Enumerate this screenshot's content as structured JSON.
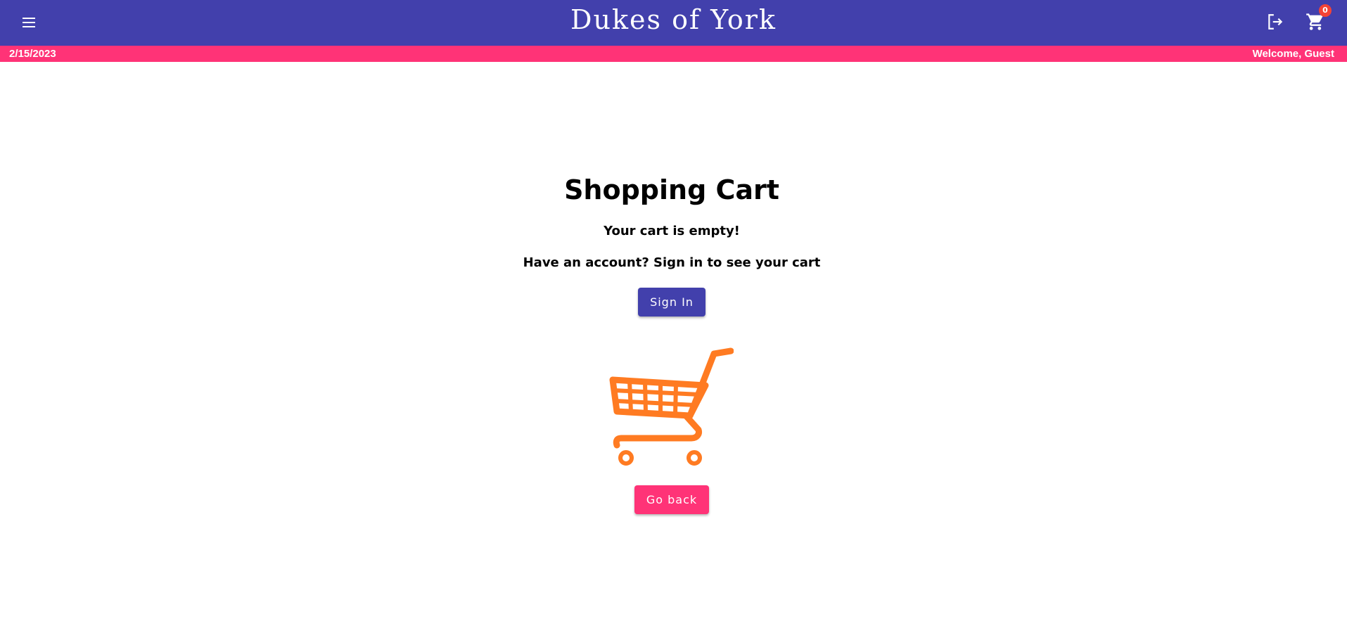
{
  "header": {
    "brand": "Dukes of York",
    "cart_count": "0",
    "icons": {
      "menu": "menu-icon",
      "logout": "logout-icon",
      "cart": "shopping-cart-icon"
    },
    "colors": {
      "primary": "#4240ac",
      "accent": "#ff3377",
      "badge": "#f44336"
    }
  },
  "statusbar": {
    "date": "2/15/2023",
    "welcome": "Welcome, Guest"
  },
  "main": {
    "title": "Shopping Cart",
    "empty_message": "Your cart is empty!",
    "account_prompt": "Have an account? Sign in to see your cart",
    "signin_label": "Sign In",
    "goback_label": "Go back",
    "illustration": "empty-cart-illustration",
    "illustration_color": "#ff7b22"
  }
}
